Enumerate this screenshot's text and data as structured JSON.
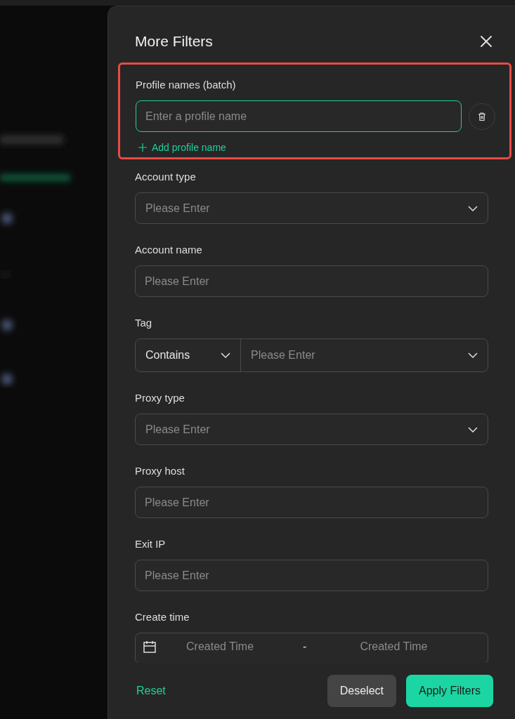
{
  "dialog": {
    "title": "More Filters"
  },
  "profile_names": {
    "label": "Profile names (batch)",
    "placeholder": "Enter a profile name",
    "focused": true,
    "highlighted": true,
    "add_label": "Add profile name"
  },
  "fields": [
    {
      "kind": "select",
      "label": "Account type",
      "placeholder": "Please Enter"
    },
    {
      "kind": "input",
      "label": "Account name",
      "placeholder": "Please Enter"
    },
    {
      "kind": "tag",
      "label": "Tag",
      "operator": "Contains",
      "placeholder": "Please Enter"
    },
    {
      "kind": "select",
      "label": "Proxy type",
      "placeholder": "Please Enter"
    },
    {
      "kind": "input",
      "label": "Proxy host",
      "placeholder": "Please Enter"
    },
    {
      "kind": "input",
      "label": "Exit IP",
      "placeholder": "Please Enter"
    },
    {
      "kind": "date",
      "label": "Create time",
      "start": "Created Time",
      "separator": "-",
      "end": "Created Time"
    }
  ],
  "footer": {
    "reset": "Reset",
    "deselect": "Deselect",
    "apply": "Apply Filters"
  }
}
